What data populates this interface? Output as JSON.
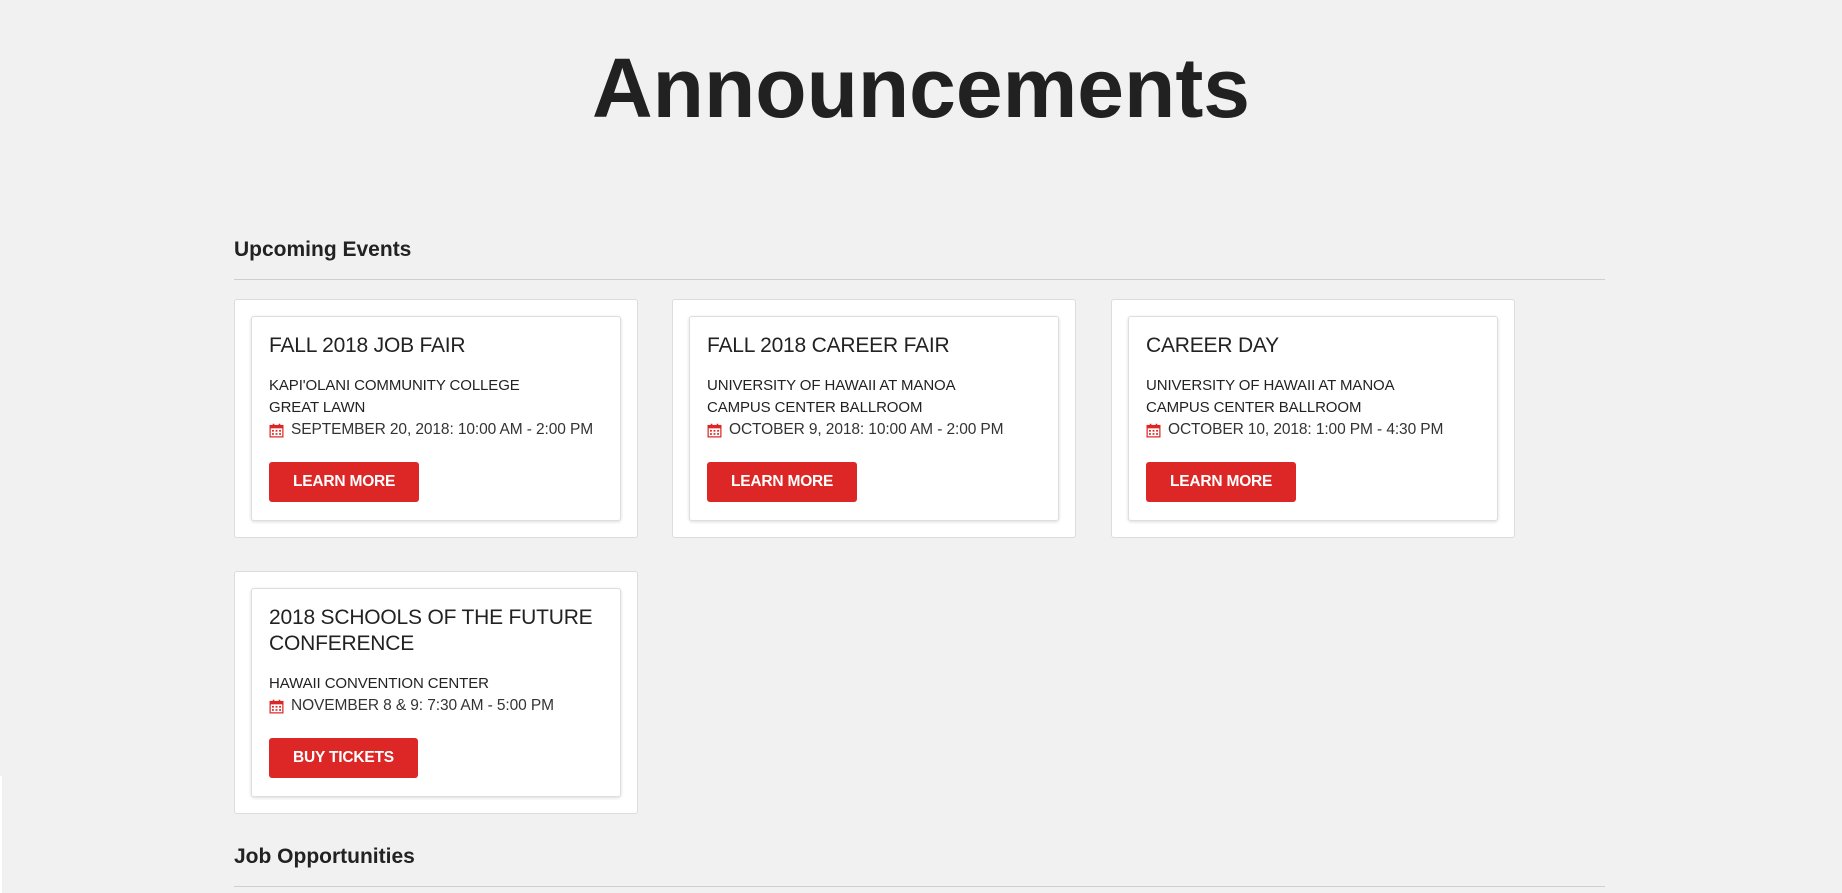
{
  "page": {
    "title": "Announcements"
  },
  "sections": {
    "upcoming_events": {
      "heading": "Upcoming Events"
    },
    "job_opportunities": {
      "heading": "Job Opportunities"
    }
  },
  "events": [
    {
      "title": "FALL 2018 JOB FAIR",
      "venue_line1": "KAPI'OLANI COMMUNITY COLLEGE",
      "venue_line2": "GREAT LAWN",
      "date": "SEPTEMBER 20, 2018: 10:00 AM - 2:00 PM",
      "button_label": "LEARN MORE"
    },
    {
      "title": "FALL 2018 CAREER FAIR",
      "venue_line1": "UNIVERSITY OF HAWAII AT MANOA",
      "venue_line2": "CAMPUS CENTER BALLROOM",
      "date": "OCTOBER 9, 2018: 10:00 AM - 2:00 PM",
      "button_label": "LEARN MORE"
    },
    {
      "title": "CAREER DAY",
      "venue_line1": "UNIVERSITY OF HAWAII AT MANOA",
      "venue_line2": "CAMPUS CENTER BALLROOM",
      "date": "OCTOBER 10, 2018: 1:00 PM - 4:30 PM",
      "button_label": "LEARN MORE"
    },
    {
      "title": "2018 SCHOOLS OF THE FUTURE CONFERENCE",
      "venue_line1": "HAWAII CONVENTION CENTER",
      "date": "NOVEMBER 8 & 9: 7:30 AM - 5:00 PM",
      "button_label": "BUY TICKETS"
    }
  ],
  "icons": {
    "date": "calendar-icon"
  },
  "colors": {
    "page_background": "#f1f1f1",
    "accent": "#dc2726",
    "text": "#222222",
    "card_background": "#ffffff"
  }
}
